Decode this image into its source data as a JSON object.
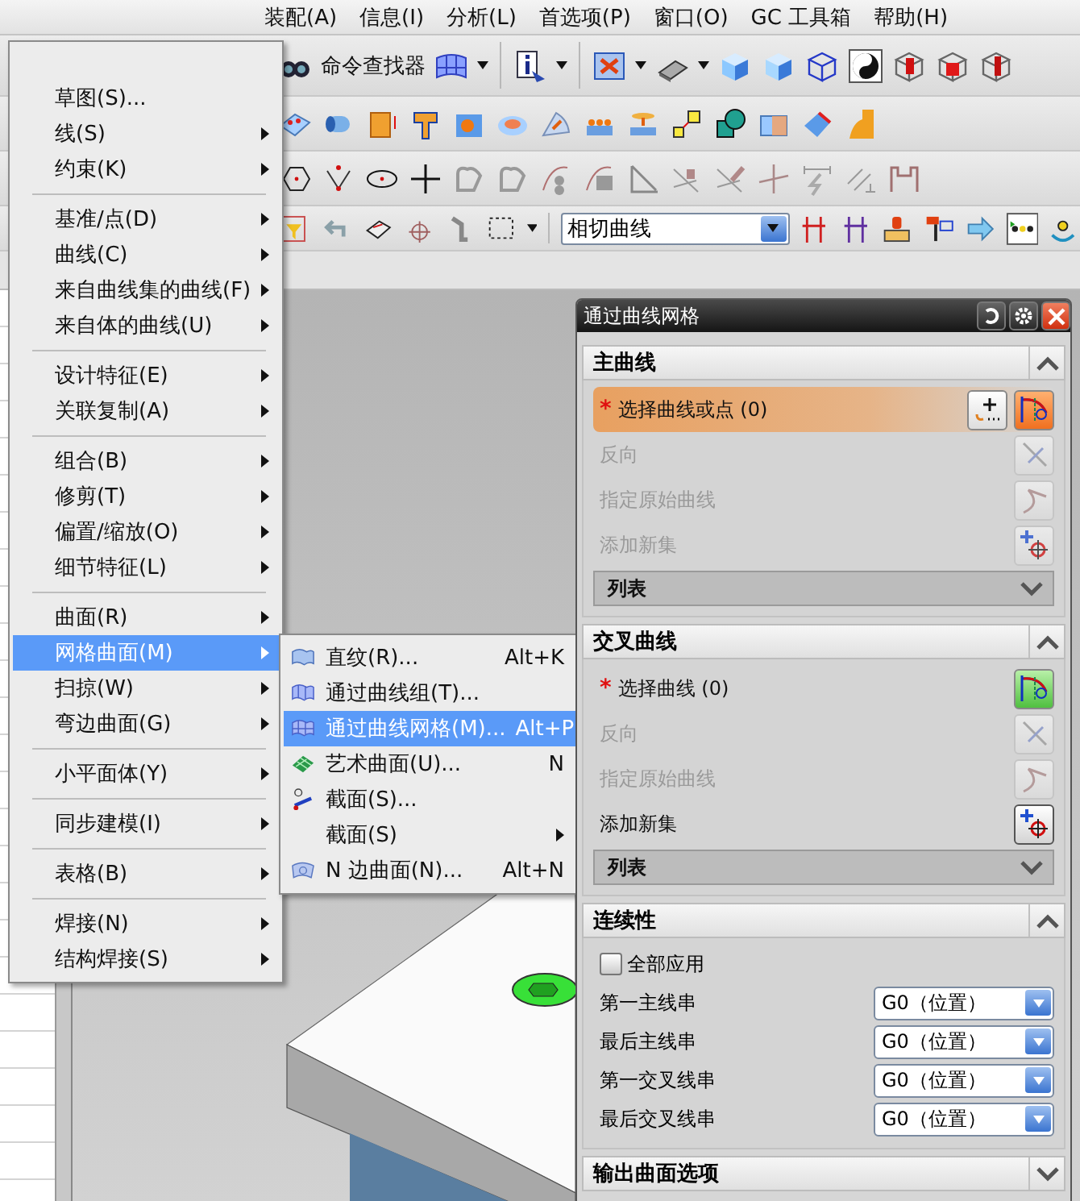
{
  "menubar": [
    "装配(A)",
    "信息(I)",
    "分析(L)",
    "首选项(P)",
    "窗口(O)",
    "GC 工具箱",
    "帮助(H)"
  ],
  "toolbar": {
    "command_finder": "命令查找器",
    "curve_rule": "相切曲线"
  },
  "insert_menu": {
    "groups": [
      [
        {
          "label": "草图(S)...",
          "submenu": false,
          "selected": false
        },
        {
          "label": "线(S)",
          "submenu": true,
          "selected": false
        },
        {
          "label": "约束(K)",
          "submenu": true,
          "selected": false
        }
      ],
      [
        {
          "label": "基准/点(D)",
          "submenu": true,
          "selected": false
        },
        {
          "label": "曲线(C)",
          "submenu": true,
          "selected": false
        },
        {
          "label": "来自曲线集的曲线(F)",
          "submenu": true,
          "selected": false
        },
        {
          "label": "来自体的曲线(U)",
          "submenu": true,
          "selected": false
        }
      ],
      [
        {
          "label": "设计特征(E)",
          "submenu": true,
          "selected": false
        },
        {
          "label": "关联复制(A)",
          "submenu": true,
          "selected": false
        }
      ],
      [
        {
          "label": "组合(B)",
          "submenu": true,
          "selected": false
        },
        {
          "label": "修剪(T)",
          "submenu": true,
          "selected": false
        },
        {
          "label": "偏置/缩放(O)",
          "submenu": true,
          "selected": false
        },
        {
          "label": "细节特征(L)",
          "submenu": true,
          "selected": false
        }
      ],
      [
        {
          "label": "曲面(R)",
          "submenu": true,
          "selected": false
        },
        {
          "label": "网格曲面(M)",
          "submenu": true,
          "selected": true
        },
        {
          "label": "扫掠(W)",
          "submenu": true,
          "selected": false
        },
        {
          "label": "弯边曲面(G)",
          "submenu": true,
          "selected": false
        }
      ],
      [
        {
          "label": "小平面体(Y)",
          "submenu": true,
          "selected": false
        }
      ],
      [
        {
          "label": "同步建模(I)",
          "submenu": true,
          "selected": false
        }
      ],
      [
        {
          "label": "表格(B)",
          "submenu": true,
          "selected": false
        }
      ],
      [
        {
          "label": "焊接(N)",
          "submenu": true,
          "selected": false
        },
        {
          "label": "结构焊接(S)",
          "submenu": true,
          "selected": false
        }
      ]
    ]
  },
  "submenu": {
    "items": [
      {
        "kind": "ruled",
        "label": "直纹(R)...",
        "shortcut": "Alt+K",
        "submenu": false,
        "selected": false
      },
      {
        "kind": "curves",
        "label": "通过曲线组(T)...",
        "submenu": false,
        "selected": false
      },
      {
        "kind": "mesh",
        "label": "通过曲线网格(M)...",
        "shortcut": "Alt+P",
        "submenu": false,
        "selected": true
      },
      {
        "kind": "studio",
        "label": "艺术曲面(U)...",
        "shortcut": "N",
        "submenu": false,
        "selected": false
      },
      {
        "kind": "section",
        "label": "截面(S)...",
        "submenu": false,
        "selected": false
      },
      {
        "kind": "none",
        "label": "截面(S)",
        "submenu": true,
        "selected": false
      },
      {
        "kind": "nsided",
        "label": "N 边曲面(N)...",
        "shortcut": "Alt+N",
        "submenu": false,
        "selected": false
      }
    ]
  },
  "dialog": {
    "title": "通过曲线网格",
    "sections": [
      {
        "title": "主曲线",
        "expanded": true,
        "rows": [
          {
            "kind": "select",
            "label": "选择曲线或点 (0)",
            "required_mark": "*",
            "active": true
          },
          {
            "kind": "reverse",
            "label": "反向",
            "disabled": true
          },
          {
            "kind": "origin",
            "label": "指定原始曲线",
            "disabled": true
          },
          {
            "kind": "add",
            "label": "添加新集",
            "disabled": true
          },
          {
            "kind": "list",
            "label": "列表",
            "expanded": false
          }
        ]
      },
      {
        "title": "交叉曲线",
        "expanded": true,
        "rows": [
          {
            "kind": "select",
            "label": "选择曲线 (0)",
            "required_mark": "*",
            "active": false
          },
          {
            "kind": "reverse",
            "label": "反向",
            "disabled": true
          },
          {
            "kind": "origin",
            "label": "指定原始曲线",
            "disabled": true
          },
          {
            "kind": "add",
            "label": "添加新集",
            "disabled": false
          },
          {
            "kind": "list",
            "label": "列表",
            "expanded": false
          }
        ]
      },
      {
        "title": "连续性",
        "expanded": true,
        "rows": [
          {
            "kind": "checkbox",
            "label": "全部应用",
            "checked": false
          },
          {
            "kind": "dropdown",
            "label": "第一主线串",
            "value": "G0（位置）"
          },
          {
            "kind": "dropdown",
            "label": "最后主线串",
            "value": "G0（位置）"
          },
          {
            "kind": "dropdown",
            "label": "第一交叉线串",
            "value": "G0（位置）"
          },
          {
            "kind": "dropdown",
            "label": "最后交叉线串",
            "value": "G0（位置）"
          }
        ]
      },
      {
        "title": "输出曲面选项",
        "expanded": false
      }
    ]
  }
}
